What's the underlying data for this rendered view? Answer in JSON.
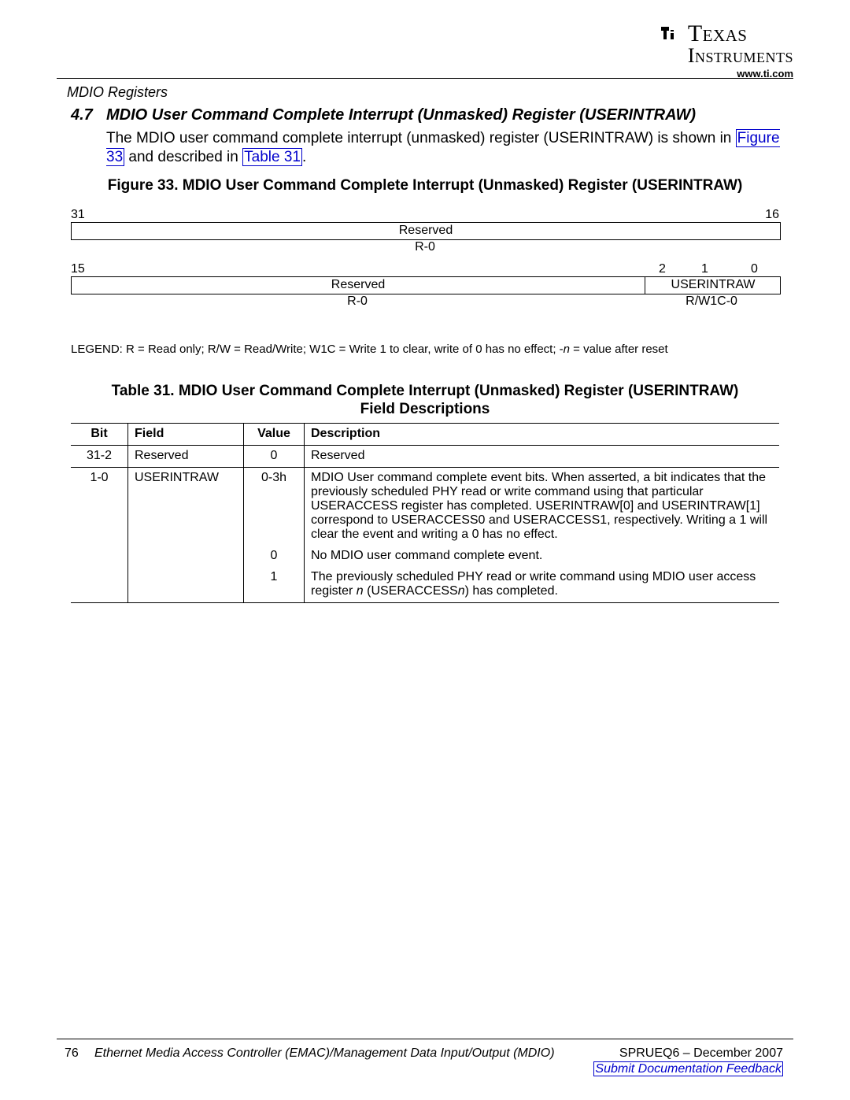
{
  "header": {
    "logo_line1": "Texas",
    "logo_line2": "Instruments",
    "url": "www.ti.com",
    "chapter": "MDIO Registers"
  },
  "section": {
    "number": "4.7",
    "title": "MDIO User Command Complete Interrupt (Unmasked) Register (USERINTRAW)"
  },
  "body": {
    "pre": "The MDIO user command complete interrupt (unmasked) register (USERINTRAW) is shown in ",
    "fig_ref": "Figure 33",
    "mid": " and described in ",
    "tbl_ref": "Table 31",
    "post": "."
  },
  "figure": {
    "caption": "Figure 33. MDIO User Command Complete Interrupt (Unmasked) Register (USERINTRAW)",
    "bits": {
      "b31": "31",
      "b16": "16",
      "b15": "15",
      "b2": "2",
      "b1": "1",
      "b0": "0"
    },
    "row1": {
      "label": "Reserved",
      "access": "R-0"
    },
    "row2": {
      "reserved": "Reserved",
      "userint": "USERINTRAW",
      "reserved_access": "R-0",
      "userint_access": "R/W1C-0"
    },
    "legend": "LEGEND: R = Read only; R/W = Read/Write; W1C = Write 1 to clear, write of 0 has no effect; -n = value after reset"
  },
  "table": {
    "caption_line1": "Table 31. MDIO User Command Complete Interrupt (Unmasked) Register (USERINTRAW)",
    "caption_line2": "Field Descriptions",
    "headers": {
      "bit": "Bit",
      "field": "Field",
      "value": "Value",
      "desc": "Description"
    },
    "rows": [
      {
        "bit": "31-2",
        "field": "Reserved",
        "value": "0",
        "desc": "Reserved"
      },
      {
        "bit": "1-0",
        "field": "USERINTRAW",
        "value": "0-3h",
        "desc": "MDIO User command complete event bits. When asserted, a bit indicates that the previously scheduled PHY read or write command using that particular USERACCESS register has completed. USERINTRAW[0] and USERINTRAW[1] correspond to USERACCESS0 and USERACCESS1, respectively. Writing a 1 will clear the event and writing a 0 has no effect."
      },
      {
        "bit": "",
        "field": "",
        "value": "0",
        "desc": "No MDIO user command complete event."
      },
      {
        "bit": "",
        "field": "",
        "value": "1",
        "desc_pre": "The previously scheduled PHY read or write command using MDIO user access register ",
        "desc_italic": "n",
        "desc_post": " (USERACCESSn) has completed."
      }
    ]
  },
  "footer": {
    "page": "76",
    "title": "Ethernet Media Access Controller (EMAC)/Management Data Input/Output (MDIO)",
    "docid": "SPRUEQ6 – December 2007",
    "link": "Submit Documentation Feedback"
  }
}
